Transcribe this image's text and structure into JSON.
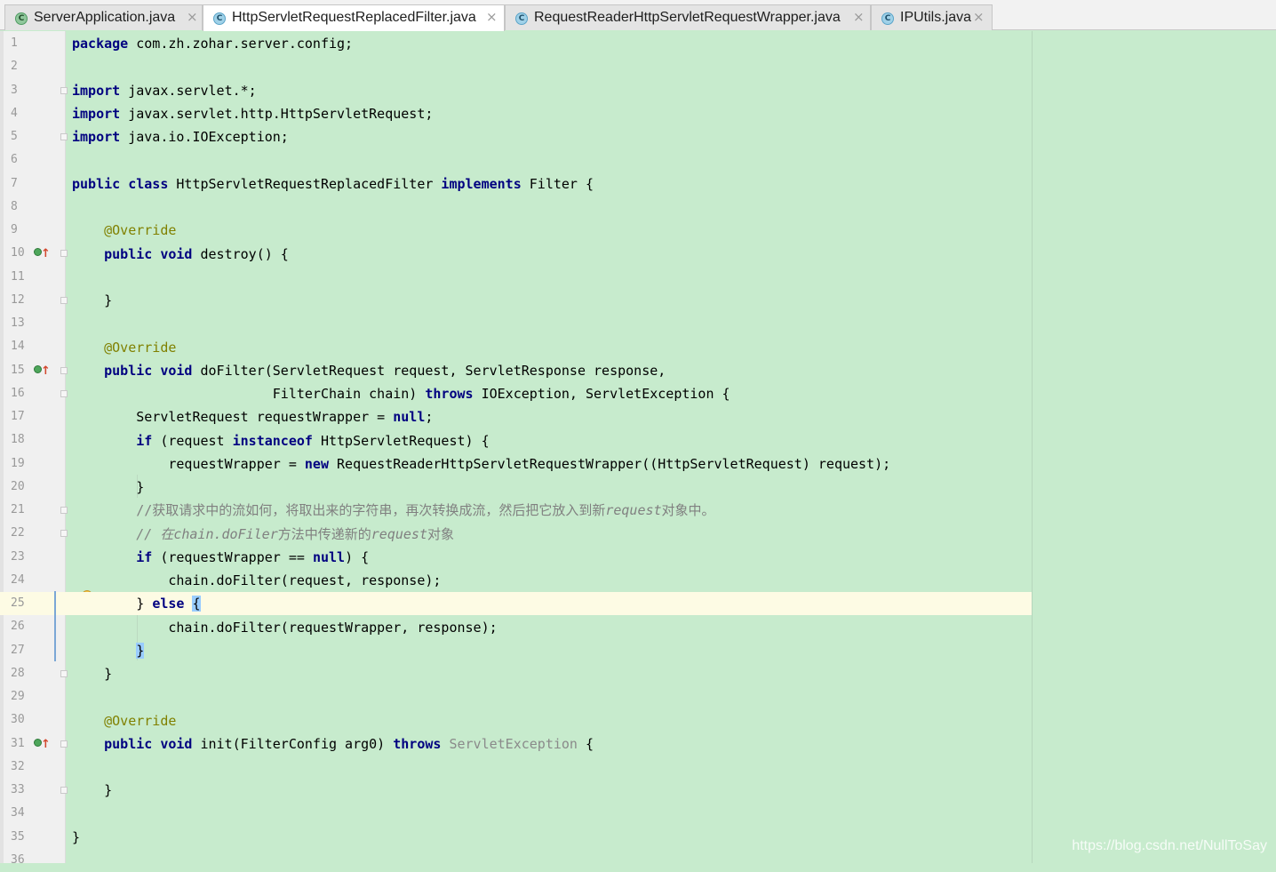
{
  "tabs": [
    {
      "name": "ServerApplication.java",
      "icon": "spring-class-icon",
      "active": false
    },
    {
      "name": "HttpServletRequestReplacedFilter.java",
      "icon": "class-icon",
      "active": true
    },
    {
      "name": "RequestReaderHttpServletRequestWrapper.java",
      "icon": "class-icon",
      "active": false
    },
    {
      "name": "IPUtils.java",
      "icon": "class-icon",
      "active": false
    }
  ],
  "tab_close_glyph": "×",
  "current_line": 25,
  "line_numbers": [
    "1",
    "2",
    "3",
    "4",
    "5",
    "6",
    "7",
    "8",
    "9",
    "10",
    "11",
    "12",
    "13",
    "14",
    "15",
    "16",
    "17",
    "18",
    "19",
    "20",
    "21",
    "22",
    "23",
    "24",
    "25",
    "26",
    "27",
    "28",
    "29",
    "30",
    "31",
    "32",
    "33",
    "34",
    "35",
    "36"
  ],
  "code": {
    "package_kw": "package",
    "package_name": " com.zh.zohar.server.config;",
    "import_kw": "import",
    "import1": " javax.servlet.*;",
    "import2": " javax.servlet.http.HttpServletRequest;",
    "import3": " java.io.IOException;",
    "public_kw": "public",
    "class_kw": "class",
    "class_name": " HttpServletRequestReplacedFilter ",
    "implements_kw": "implements",
    "filter_rest": " Filter {",
    "override": "@Override",
    "void_kw": "void",
    "destroy_sig": " destroy() {",
    "close_brace": "}",
    "dofilter_sig": " doFilter(ServletRequest request, ServletResponse response,",
    "dofilter_cont": "FilterChain chain) ",
    "throws_kw": "throws",
    "dofilter_exc": " IOException, ServletException {",
    "wrapper_decl": "ServletRequest requestWrapper = ",
    "null_kw": "null",
    "semicolon": ";",
    "if_kw": "if",
    "if1_open": " (request ",
    "instanceof_kw": "instanceof",
    "if1_close": " HttpServletRequest) {",
    "assign_start": "requestWrapper = ",
    "new_kw": "new",
    "assign_rest": " RequestReaderHttpServletRequestWrapper((HttpServletRequest) request);",
    "comment1_a": "//获取请求中的流如何，将取出来的字符串，再次转换成流，然后把它放入到新",
    "comment1_b": "request",
    "comment1_c": "对象中。",
    "comment2_a": "// 在",
    "comment2_b": "chain.doFiler",
    "comment2_c": "方法中传递新的",
    "comment2_d": "request",
    "comment2_e": "对象",
    "if2_open": " (requestWrapper == ",
    "if2_close": ") {",
    "call1": "chain.doFilter(request, response);",
    "else_close": "} ",
    "else_kw": "else",
    "space": " ",
    "open_brace": "{",
    "call2": "chain.doFilter(requestWrapper, response);",
    "init_sig": " init(FilterConfig arg0) ",
    "init_exc": "ServletException",
    "init_end": " {"
  },
  "watermark": "https://blog.csdn.net/NullToSay"
}
